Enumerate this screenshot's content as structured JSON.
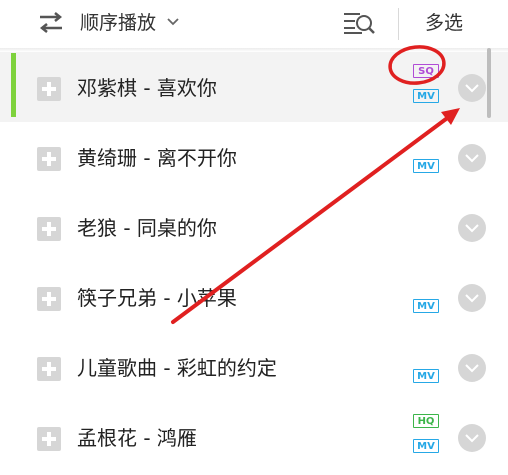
{
  "toolbar": {
    "mode_label": "顺序播放",
    "mode_icon": "shuffle-arrows-icon",
    "dropdown_icon": "chevron-down-icon",
    "sort_icon": "sort-search-icon",
    "multi_select_label": "多选"
  },
  "songs": [
    {
      "title": "邓紫棋 - 喜欢你",
      "badges": [
        "SQ",
        "MV"
      ],
      "active": true
    },
    {
      "title": "黄绮珊 - 离不开你",
      "badges": [
        "MV"
      ],
      "active": false
    },
    {
      "title": "老狼 - 同桌的你",
      "badges": [],
      "active": false
    },
    {
      "title": "筷子兄弟 - 小苹果",
      "badges": [
        "MV"
      ],
      "active": false
    },
    {
      "title": "儿童歌曲 - 彩虹的约定",
      "badges": [
        "MV"
      ],
      "active": false
    },
    {
      "title": "孟根花 - 鸿雁",
      "badges": [
        "HQ",
        "MV"
      ],
      "active": false
    }
  ],
  "colors": {
    "active_indicator": "#7ed23c",
    "mv_badge": "#26a8e6",
    "sq_badge": "#b04cd6",
    "hq_badge": "#3cb54a",
    "annotation": "#e02020"
  }
}
